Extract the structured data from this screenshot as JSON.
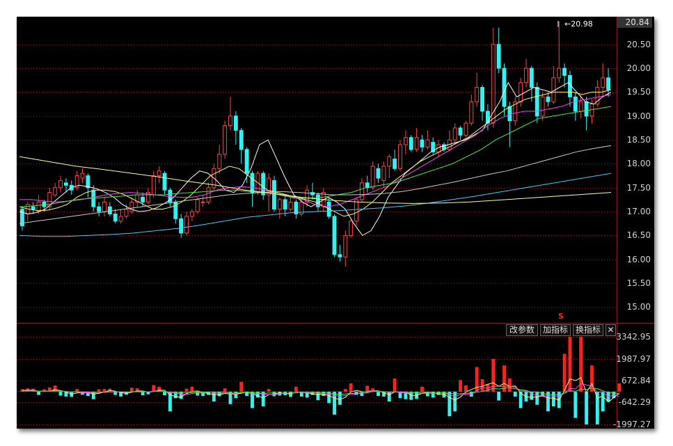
{
  "price_axis": {
    "labels": [
      "20.84",
      "20.50",
      "20.00",
      "19.50",
      "19.00",
      "18.50",
      "18.00",
      "17.50",
      "17.00",
      "16.50",
      "16.00",
      "15.50",
      "15.00"
    ],
    "values": [
      20.84,
      20.5,
      20.0,
      19.5,
      19.0,
      18.5,
      18.0,
      17.5,
      17.0,
      16.5,
      16.0,
      15.5,
      15.0
    ],
    "last_price": "20.84"
  },
  "volume_axis": {
    "labels": [
      "3342.95",
      "1987.97",
      "672.84",
      "-642.29",
      "-1997.27"
    ],
    "values": [
      3342.95,
      1987.97,
      672.84,
      -642.29,
      -1997.27
    ]
  },
  "high_annotation": "20.98",
  "signal_marker": "S",
  "toolbar": {
    "modify_params": "改参数",
    "add_indicator": "加指标",
    "switch_indicator": "换指标",
    "close_symbol": "✕"
  },
  "colors": {
    "up": "#ff4444",
    "down": "#35f0f0",
    "ma5": "#ffffff",
    "ma10": "#ffff66",
    "ma20": "#ff44ff",
    "ma30": "#44ee44",
    "ma60": "#cccccc",
    "ma120": "#44ccff",
    "ma250": "#ffff99",
    "grid": "#8b1a1a"
  },
  "chart_data": {
    "type": "candlestick",
    "title": "",
    "ylim": [
      14.7,
      21.05
    ],
    "candles": [
      [
        17.05,
        16.7,
        17.1,
        16.6
      ],
      [
        16.95,
        17.15,
        17.2,
        16.8
      ],
      [
        17.1,
        17.05,
        17.2,
        16.95
      ],
      [
        17.0,
        17.2,
        17.35,
        16.95
      ],
      [
        17.2,
        17.1,
        17.25,
        17.0
      ],
      [
        17.1,
        17.4,
        17.5,
        17.05
      ],
      [
        17.35,
        17.5,
        17.6,
        17.3
      ],
      [
        17.5,
        17.65,
        17.75,
        17.4
      ],
      [
        17.6,
        17.55,
        17.7,
        17.4
      ],
      [
        17.55,
        17.45,
        17.65,
        17.35
      ],
      [
        17.5,
        17.75,
        17.85,
        17.45
      ],
      [
        17.7,
        17.8,
        17.9,
        17.6
      ],
      [
        17.75,
        17.5,
        17.8,
        17.3
      ],
      [
        17.45,
        17.1,
        17.55,
        17.0
      ],
      [
        17.1,
        17.0,
        17.2,
        16.9
      ],
      [
        17.0,
        17.2,
        17.3,
        16.9
      ],
      [
        17.1,
        16.95,
        17.2,
        16.9
      ],
      [
        16.95,
        16.8,
        17.05,
        16.75
      ],
      [
        16.8,
        16.9,
        17.05,
        16.75
      ],
      [
        16.9,
        17.05,
        17.15,
        16.85
      ],
      [
        17.0,
        17.2,
        17.3,
        16.95
      ],
      [
        17.2,
        17.35,
        17.45,
        17.1
      ],
      [
        17.3,
        17.2,
        17.4,
        17.1
      ],
      [
        17.2,
        17.4,
        17.5,
        17.15
      ],
      [
        17.35,
        17.75,
        17.85,
        17.3
      ],
      [
        17.75,
        17.85,
        17.95,
        17.6
      ],
      [
        17.8,
        17.45,
        17.85,
        17.35
      ],
      [
        17.45,
        17.2,
        17.5,
        17.1
      ],
      [
        17.2,
        16.85,
        17.25,
        16.75
      ],
      [
        16.85,
        16.55,
        16.95,
        16.45
      ],
      [
        16.55,
        16.9,
        17.0,
        16.5
      ],
      [
        16.9,
        17.0,
        17.05,
        16.8
      ],
      [
        17.0,
        17.25,
        17.3,
        16.95
      ],
      [
        17.2,
        17.2,
        17.35,
        17.1
      ],
      [
        17.2,
        17.5,
        17.6,
        17.15
      ],
      [
        17.5,
        17.9,
        18.0,
        17.45
      ],
      [
        17.9,
        18.2,
        18.4,
        17.8
      ],
      [
        18.2,
        18.8,
        18.9,
        18.1
      ],
      [
        18.8,
        19.0,
        19.4,
        18.7
      ],
      [
        19.0,
        18.7,
        19.1,
        18.4
      ],
      [
        18.7,
        18.3,
        18.75,
        18.0
      ],
      [
        18.3,
        17.8,
        18.35,
        17.6
      ],
      [
        17.8,
        17.4,
        17.85,
        17.1
      ],
      [
        17.4,
        17.8,
        17.85,
        17.35
      ],
      [
        17.8,
        17.35,
        17.85,
        17.25
      ],
      [
        17.35,
        17.7,
        17.8,
        17.0
      ],
      [
        17.65,
        17.05,
        17.75,
        17.0
      ],
      [
        17.05,
        17.25,
        17.3,
        16.85
      ],
      [
        17.25,
        17.05,
        17.35,
        16.9
      ],
      [
        17.05,
        17.2,
        17.3,
        17.0
      ],
      [
        17.2,
        16.95,
        17.25,
        16.85
      ],
      [
        16.95,
        17.2,
        17.3,
        16.9
      ],
      [
        17.2,
        17.45,
        17.55,
        17.1
      ],
      [
        17.4,
        17.35,
        17.6,
        17.25
      ],
      [
        17.35,
        17.1,
        17.4,
        17.0
      ],
      [
        17.1,
        17.4,
        17.5,
        17.0
      ],
      [
        17.2,
        16.9,
        17.3,
        16.85
      ],
      [
        16.9,
        16.1,
        16.95,
        16.05
      ],
      [
        16.1,
        16.05,
        16.3,
        15.95
      ],
      [
        16.05,
        16.5,
        16.6,
        15.85
      ],
      [
        16.5,
        16.8,
        16.85,
        16.45
      ],
      [
        16.8,
        17.25,
        17.3,
        16.7
      ],
      [
        17.25,
        17.6,
        17.7,
        17.2
      ],
      [
        17.6,
        17.5,
        17.75,
        17.4
      ],
      [
        17.5,
        17.95,
        18.05,
        17.45
      ],
      [
        17.9,
        17.7,
        18.0,
        17.6
      ],
      [
        17.65,
        17.95,
        18.05,
        17.5
      ],
      [
        17.95,
        18.15,
        18.2,
        17.7
      ],
      [
        18.1,
        17.9,
        18.3,
        17.85
      ],
      [
        17.9,
        18.4,
        18.5,
        17.85
      ],
      [
        18.4,
        18.55,
        18.7,
        18.2
      ],
      [
        18.55,
        18.3,
        18.6,
        18.25
      ],
      [
        18.3,
        18.55,
        18.75,
        18.25
      ],
      [
        18.5,
        18.35,
        18.6,
        18.25
      ],
      [
        18.35,
        18.5,
        18.7,
        18.3
      ],
      [
        18.45,
        18.25,
        18.55,
        18.2
      ],
      [
        18.25,
        18.4,
        18.5,
        18.15
      ],
      [
        18.4,
        18.3,
        18.45,
        18.25
      ],
      [
        18.3,
        18.5,
        18.7,
        18.25
      ],
      [
        18.5,
        18.75,
        18.85,
        18.4
      ],
      [
        18.75,
        18.6,
        18.8,
        18.5
      ],
      [
        18.6,
        18.85,
        18.9,
        18.55
      ],
      [
        18.85,
        19.3,
        19.45,
        18.8
      ],
      [
        19.3,
        19.6,
        19.9,
        19.2
      ],
      [
        19.6,
        19.1,
        19.65,
        18.9
      ],
      [
        19.1,
        18.85,
        19.25,
        18.7
      ],
      [
        18.85,
        20.5,
        20.85,
        18.75
      ],
      [
        20.5,
        20.0,
        20.85,
        19.9
      ],
      [
        20.0,
        19.2,
        20.1,
        19.0
      ],
      [
        19.2,
        18.9,
        19.3,
        18.35
      ],
      [
        18.9,
        19.3,
        19.4,
        18.8
      ],
      [
        19.3,
        19.7,
        19.8,
        19.2
      ],
      [
        19.7,
        20.0,
        20.2,
        19.6
      ],
      [
        20.0,
        19.6,
        20.05,
        19.3
      ],
      [
        19.6,
        19.0,
        19.7,
        18.85
      ],
      [
        19.0,
        19.4,
        19.5,
        18.9
      ],
      [
        19.4,
        19.3,
        19.5,
        19.2
      ],
      [
        19.3,
        19.8,
        20.05,
        19.25
      ],
      [
        19.8,
        20.0,
        20.98,
        19.7
      ],
      [
        20.0,
        19.85,
        20.1,
        19.6
      ],
      [
        19.85,
        19.4,
        19.95,
        19.2
      ],
      [
        19.4,
        19.1,
        19.5,
        18.9
      ],
      [
        19.1,
        19.3,
        19.45,
        18.95
      ],
      [
        19.3,
        19.0,
        19.4,
        18.7
      ],
      [
        19.0,
        19.25,
        19.35,
        18.85
      ],
      [
        19.25,
        19.6,
        19.75,
        19.2
      ],
      [
        19.6,
        19.8,
        20.1,
        19.4
      ],
      [
        19.8,
        19.55,
        20.0,
        19.4
      ]
    ],
    "volume": [
      150,
      200,
      180,
      -200,
      140,
      260,
      380,
      -240,
      -300,
      -320,
      160,
      -180,
      -260,
      -460,
      140,
      160,
      180,
      -200,
      -300,
      -180,
      240,
      200,
      -220,
      -160,
      400,
      300,
      -220,
      -1200,
      -400,
      -440,
      180,
      300,
      -240,
      -260,
      -200,
      -600,
      -280,
      200,
      -760,
      -400,
      600,
      -260,
      -1000,
      -360,
      -900,
      160,
      -280,
      -240,
      -220,
      -320,
      300,
      -300,
      -360,
      -200,
      -520,
      -260,
      -700,
      -1400,
      -800,
      160,
      500,
      -200,
      -260,
      360,
      200,
      -260,
      -300,
      -600,
      800,
      -400,
      -460,
      -500,
      -440,
      300,
      -280,
      -360,
      -200,
      -360,
      -1500,
      -1200,
      700,
      380,
      -300,
      1500,
      760,
      460,
      2000,
      -540,
      1600,
      800,
      -300,
      -1000,
      -600,
      -500,
      -800,
      -300,
      -1200,
      -900,
      -1000,
      2300,
      3342,
      -1600,
      3342,
      -2000,
      1600,
      -1997,
      -1200,
      -600,
      -400,
      500
    ],
    "volume_ylim": [
      -1997.27,
      3342.95
    ],
    "series_ma": [
      {
        "name": "MA5",
        "color": "#ffffff",
        "values": [
          17.0,
          16.95,
          16.98,
          17.05,
          17.2,
          17.35,
          17.5,
          17.55,
          17.52,
          17.48,
          17.4,
          17.3,
          17.15,
          17.05,
          17.0,
          17.02,
          17.08,
          17.18,
          17.3,
          17.5,
          17.7,
          17.85,
          17.8,
          17.65,
          17.45,
          17.4,
          17.55,
          17.9,
          18.4,
          18.5,
          18.1,
          17.7,
          17.35,
          17.2,
          17.1,
          17.2,
          17.3,
          17.2,
          17.05,
          16.75,
          16.5,
          16.6,
          16.9,
          17.3,
          17.55,
          17.8,
          17.95,
          18.1,
          18.25,
          18.35,
          18.4,
          18.45,
          18.5,
          18.6,
          18.7,
          19.0,
          19.3,
          19.7,
          19.4,
          19.5,
          19.6,
          19.55,
          19.5,
          19.6,
          19.7,
          19.5,
          19.3,
          19.25,
          19.4,
          19.5
        ]
      },
      {
        "name": "MA10",
        "color": "#ffff66",
        "values": [
          17.1,
          17.05,
          17.02,
          17.03,
          17.08,
          17.15,
          17.3,
          17.4,
          17.45,
          17.45,
          17.42,
          17.35,
          17.25,
          17.15,
          17.05,
          17.05,
          17.1,
          17.2,
          17.35,
          17.55,
          17.75,
          17.85,
          17.95,
          17.9,
          17.75,
          17.6,
          17.45,
          17.4,
          17.35,
          17.3,
          17.25,
          17.2,
          17.1,
          17.0,
          16.9,
          16.95,
          17.05,
          17.2,
          17.4,
          17.6,
          17.75,
          17.9,
          18.05,
          18.15,
          18.25,
          18.35,
          18.45,
          18.55,
          18.7,
          18.85,
          19.0,
          19.15,
          19.25,
          19.35,
          19.4,
          19.45,
          19.5,
          19.5,
          19.5,
          19.45,
          19.5,
          19.5,
          19.55
        ]
      },
      {
        "name": "MA20",
        "color": "#ff44ff",
        "values": [
          17.25,
          17.25,
          17.22,
          17.2,
          17.22,
          17.25,
          17.3,
          17.35,
          17.38,
          17.4,
          17.38,
          17.35,
          17.32,
          17.3,
          17.3,
          17.35,
          17.45,
          17.5,
          17.52,
          17.5,
          17.45,
          17.35,
          17.3,
          17.25,
          17.15,
          17.1,
          17.15,
          17.25,
          17.35,
          17.45,
          17.55,
          17.7,
          17.85,
          18.0,
          18.15,
          18.3,
          18.45,
          18.6,
          18.8,
          18.95,
          19.05,
          19.1,
          19.1,
          19.15,
          19.2,
          19.3,
          19.35,
          19.4,
          19.45
        ]
      },
      {
        "name": "MA30",
        "color": "#44ee44",
        "values": [
          17.1,
          17.12,
          17.15,
          17.2,
          17.25,
          17.28,
          17.3,
          17.32,
          17.35,
          17.35,
          17.35,
          17.38,
          17.4,
          17.42,
          17.45,
          17.45,
          17.42,
          17.4,
          17.35,
          17.3,
          17.28,
          17.3,
          17.35,
          17.4,
          17.5,
          17.55,
          17.6,
          17.7,
          17.8,
          17.9,
          18.0,
          18.15,
          18.3,
          18.5,
          18.65,
          18.8,
          18.95,
          19.0,
          19.05,
          19.1,
          19.15,
          19.2
        ]
      },
      {
        "name": "MA60",
        "color": "#cccccc",
        "values": [
          16.75,
          16.8,
          16.85,
          16.9,
          16.95,
          17.0,
          17.05,
          17.1,
          17.15,
          17.2,
          17.25,
          17.3,
          17.35,
          17.38,
          17.4,
          17.42,
          17.4,
          17.38,
          17.35,
          17.35,
          17.36,
          17.38,
          17.42,
          17.48,
          17.55,
          17.62,
          17.7,
          17.78,
          17.85,
          17.95,
          18.05,
          18.15,
          18.25,
          18.32,
          18.38
        ]
      },
      {
        "name": "MA120",
        "color": "#44ccff",
        "values": [
          16.5,
          16.48,
          16.48,
          16.5,
          16.52,
          16.55,
          16.6,
          16.65,
          16.72,
          16.8,
          16.88,
          16.93,
          16.98,
          17.0,
          17.02,
          17.05,
          17.08,
          17.12,
          17.18,
          17.25,
          17.32,
          17.4,
          17.48,
          17.56,
          17.64,
          17.72,
          17.8
        ]
      },
      {
        "name": "MA250",
        "color": "#ffff99",
        "values": [
          18.15,
          18.05,
          17.95,
          17.88,
          17.8,
          17.72,
          17.63,
          17.55,
          17.45,
          17.38,
          17.3,
          17.24,
          17.2,
          17.18,
          17.17,
          17.18,
          17.2,
          17.24,
          17.28,
          17.32,
          17.36,
          17.4
        ]
      }
    ]
  }
}
